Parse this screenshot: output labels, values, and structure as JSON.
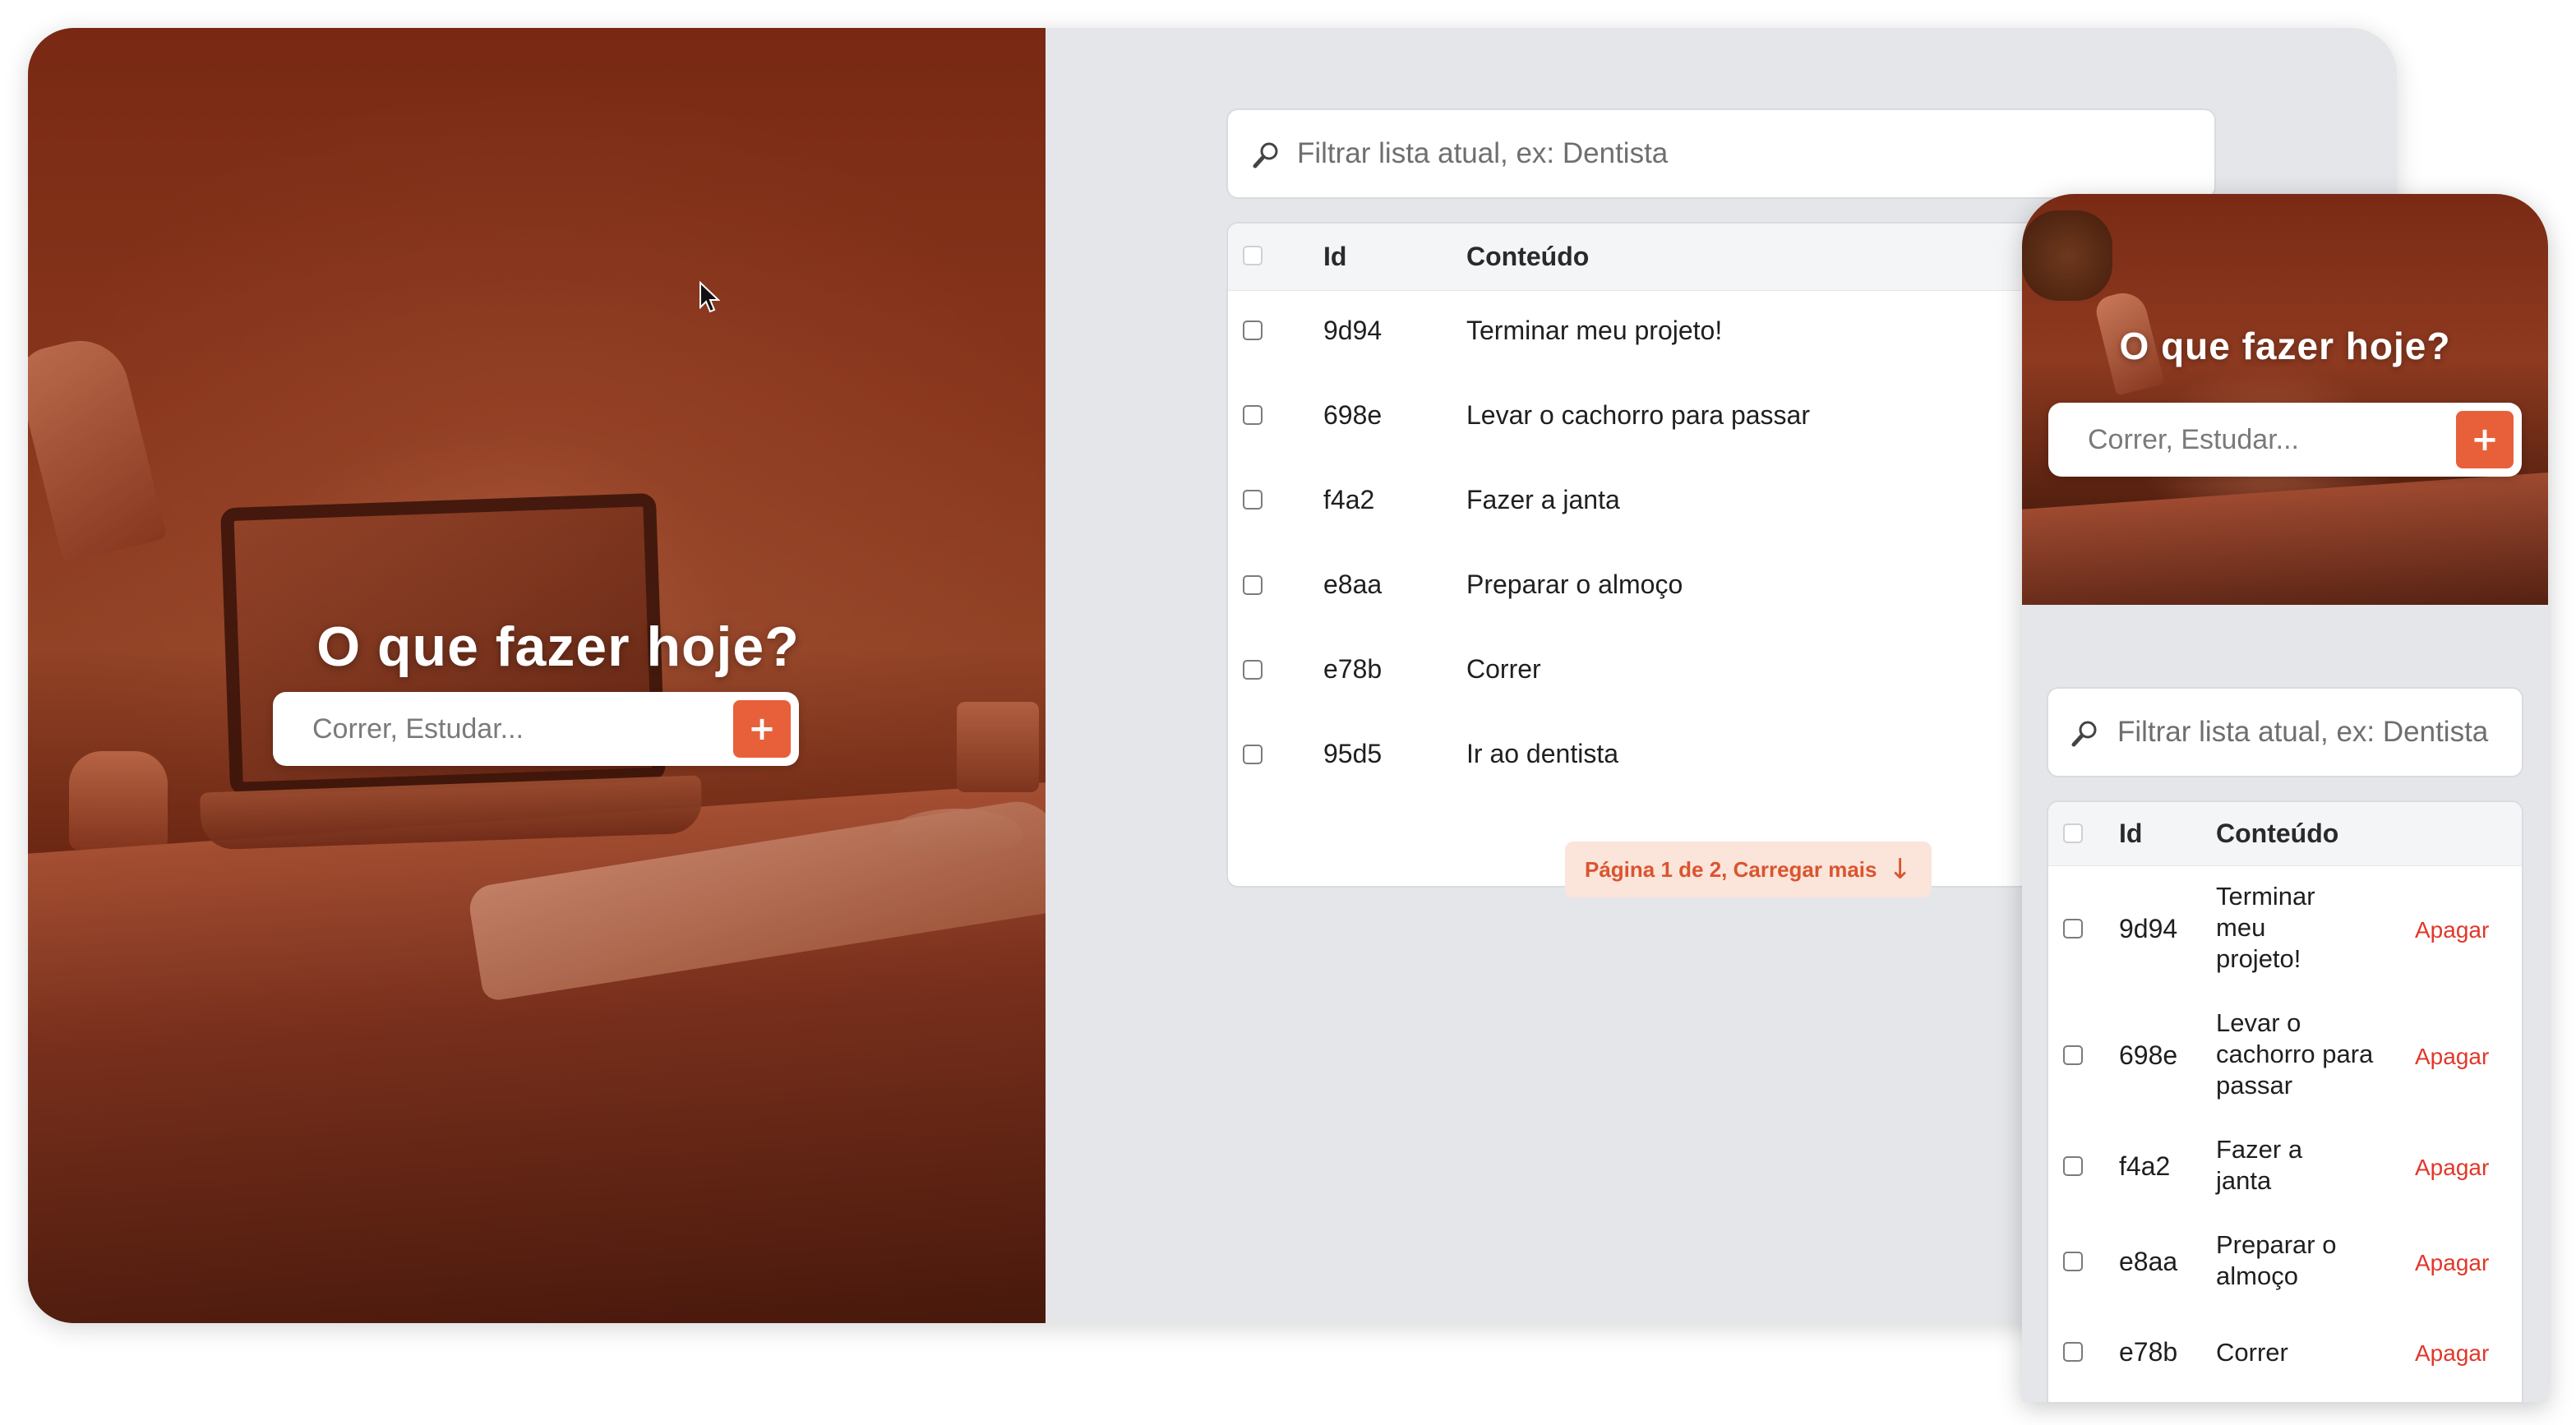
{
  "hero": {
    "title": "O que fazer hoje?",
    "add_placeholder": "Correr, Estudar...",
    "add_button_label": "+"
  },
  "filter": {
    "icon": "magnifier-icon",
    "placeholder": "Filtrar lista atual, ex: Dentista"
  },
  "table": {
    "columns": [
      "Id",
      "Conteúdo"
    ],
    "delete_label": "Apagar",
    "rows": [
      {
        "id": "9d94",
        "content": "Terminar meu projeto!"
      },
      {
        "id": "698e",
        "content": "Levar o cachorro para passar"
      },
      {
        "id": "f4a2",
        "content": "Fazer a janta"
      },
      {
        "id": "e8aa",
        "content": "Preparar o almoço"
      },
      {
        "id": "e78b",
        "content": "Correr"
      },
      {
        "id": "95d5",
        "content": "Ir ao dentista"
      }
    ]
  },
  "pagination": {
    "label": "Página 1 de 2, Carregar mais",
    "arrow": "↓"
  },
  "mobile": {
    "title": "O que fazer hoje?",
    "add_placeholder": "Correr, Estudar...",
    "add_button_label": "+",
    "filter_placeholder": "Filtrar lista atual, ex: Dentista",
    "columns": [
      "Id",
      "Conteúdo"
    ],
    "delete_label": "Apagar",
    "rows": [
      {
        "id": "9d94",
        "content": "Terminar meu projeto!"
      },
      {
        "id": "698e",
        "content": "Levar o cachorro para passar"
      },
      {
        "id": "f4a2",
        "content": "Fazer a janta"
      },
      {
        "id": "e8aa",
        "content": "Preparar o almoço"
      },
      {
        "id": "e78b",
        "content": "Correr"
      }
    ]
  },
  "colors": {
    "accent": "#e8603a",
    "delete": "#e2372a",
    "load_more_bg": "#fbe4da",
    "page_bg": "#e5e6ea"
  }
}
